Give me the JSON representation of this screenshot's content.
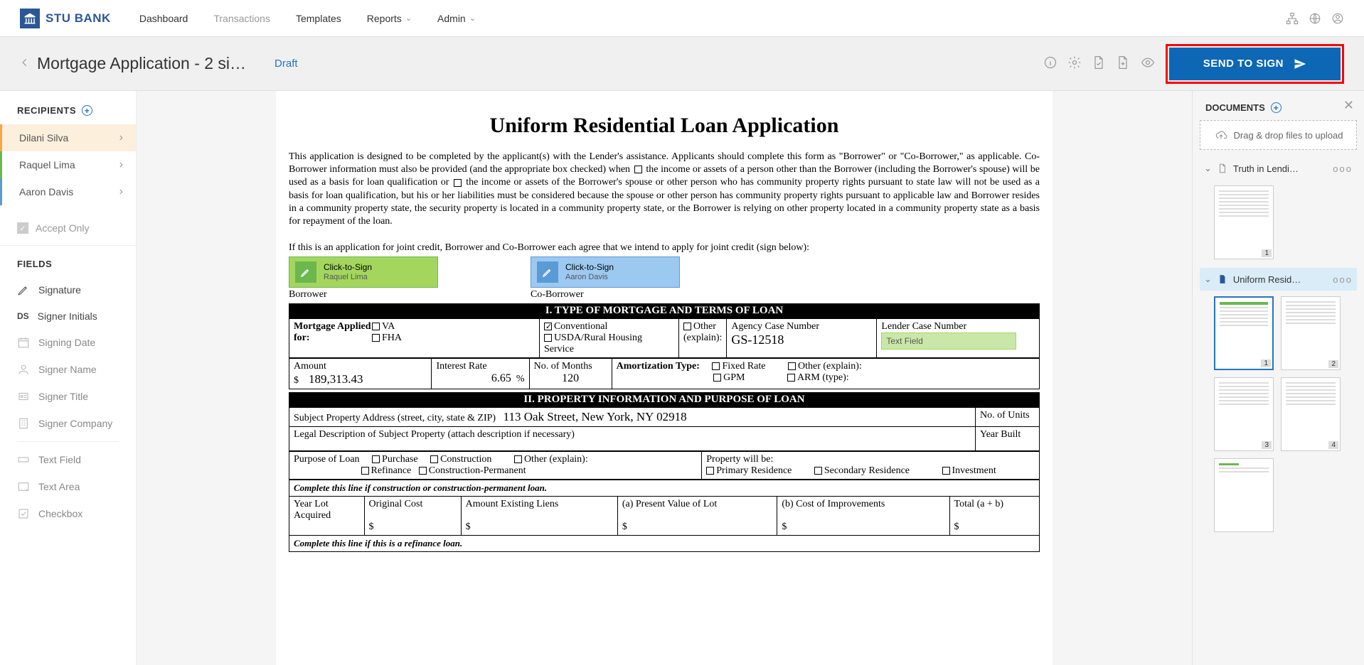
{
  "brand": {
    "name": "STU BANK"
  },
  "nav": {
    "items": [
      {
        "label": "Dashboard"
      },
      {
        "label": "Transactions"
      },
      {
        "label": "Templates"
      },
      {
        "label": "Reports",
        "dropdown": true
      },
      {
        "label": "Admin",
        "dropdown": true
      }
    ]
  },
  "subheader": {
    "title": "Mortgage Application - 2 si…",
    "status": "Draft",
    "send_label": "SEND TO SIGN"
  },
  "left": {
    "recipients_header": "RECIPIENTS",
    "recipients": [
      {
        "name": "Dilani Silva"
      },
      {
        "name": "Raquel Lima"
      },
      {
        "name": "Aaron Davis"
      }
    ],
    "accept_only": "Accept Only",
    "fields_header": "FIELDS",
    "fields": [
      {
        "label": "Signature",
        "dark": true
      },
      {
        "label": "Signer Initials",
        "dark": true,
        "prefix": "DS"
      },
      {
        "label": "Signing Date"
      },
      {
        "label": "Signer Name"
      },
      {
        "label": "Signer Title"
      },
      {
        "label": "Signer Company"
      }
    ],
    "fields2": [
      {
        "label": "Text Field"
      },
      {
        "label": "Text Area"
      },
      {
        "label": "Checkbox"
      }
    ]
  },
  "document": {
    "title": "Uniform Residential Loan Application",
    "intro_pre": "This application is designed to be completed by the applicant(s) with the Lender's assistance. Applicants should complete this form as \"Borrower\" or \"Co-Borrower,\" as applicable. Co-Borrower information must also be provided (and the appropriate box checked) when ",
    "intro_mid": " the income or assets of a person other than the Borrower (including the Borrower's spouse) will be used as a basis for loan qualification or ",
    "intro_post": " the income or assets of the Borrower's spouse or other person who has community property rights pursuant to state law will not be used as a basis for loan qualification, but his or her liabilities must be considered because the spouse or other person has community property rights pursuant to applicable law and Borrower resides in a community property state, the security property is located in a community property state, or the Borrower is relying on other property located in a community property state as a basis for repayment of the loan.",
    "joint_credit": "If this is an application for joint credit, Borrower and Co-Borrower each agree that we intend to apply for joint credit (sign below):",
    "click_to_sign": "Click-to-Sign",
    "sign1_name": "Raquel Lima",
    "sign2_name": "Aaron Davis",
    "borrower_label": "Borrower",
    "coborrower_label": "Co-Borrower",
    "section1": "I. TYPE OF MORTGAGE AND TERMS OF LOAN",
    "mortgage_applied": "Mortgage Applied for:",
    "opt_va": "VA",
    "opt_fha": "FHA",
    "opt_conventional": "Conventional",
    "opt_usda": "USDA/Rural Housing Service",
    "opt_other_explain": "Other (explain):",
    "agency_case_label": "Agency Case Number",
    "agency_case_value": "GS-12518",
    "lender_case_label": "Lender Case Number",
    "text_field_placeholder": "Text Field",
    "amount_label": "Amount",
    "amount_currency": "$",
    "amount_value": "189,313.43",
    "rate_label": "Interest Rate",
    "rate_value": "6.65",
    "rate_pct": "%",
    "months_label": "No. of Months",
    "months_value": "120",
    "amort_label": "Amortization Type:",
    "amort_fixed": "Fixed Rate",
    "amort_gpm": "GPM",
    "amort_other": "Other (explain):",
    "amort_arm": "ARM (type):",
    "section2": "II. PROPERTY INFORMATION AND PURPOSE OF LOAN",
    "subject_addr_label": "Subject Property Address (street, city, state & ZIP)",
    "subject_addr_value": "113 Oak Street, New York, NY 02918",
    "units_label": "No. of Units",
    "legal_desc": "Legal Description of Subject Property (attach description if necessary)",
    "year_built": "Year Built",
    "purpose_label": "Purpose of Loan",
    "purpose_purchase": "Purchase",
    "purpose_refinance": "Refinance",
    "purpose_construction": "Construction",
    "purpose_construction_perm": "Construction-Permanent",
    "purpose_other": "Other (explain):",
    "prop_will_be": "Property will be:",
    "prop_primary": "Primary Residence",
    "prop_secondary": "Secondary Residence",
    "prop_investment": "Investment",
    "construction_line": "Complete this line if construction or construction-permanent loan.",
    "col_year_lot": "Year Lot Acquired",
    "col_orig_cost": "Original Cost",
    "col_existing_liens": "Amount Existing Liens",
    "col_present_value": "(a) Present Value of Lot",
    "col_improvements": "(b) Cost of Improvements",
    "col_total": "Total (a + b)",
    "dollar": "$",
    "refinance_line": "Complete this line if this is a refinance loan."
  },
  "right": {
    "documents_header": "DOCUMENTS",
    "drag_drop": "Drag & drop files to upload",
    "doc1": "Truth in Lendi…",
    "doc2": "Uniform Resid…",
    "dots": "ooo",
    "pages_doc1": [
      "1"
    ],
    "pages_doc2": [
      "1",
      "2",
      "3",
      "4"
    ]
  }
}
